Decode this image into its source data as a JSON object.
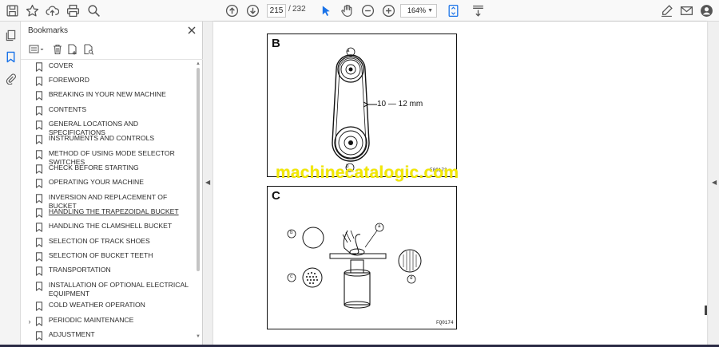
{
  "toolbar": {
    "page_current": "215",
    "page_separator": "/",
    "page_total": "232",
    "zoom": "164%"
  },
  "bookmarks": {
    "title": "Bookmarks",
    "items": [
      {
        "label": "COVER",
        "caret": ""
      },
      {
        "label": "FOREWORD",
        "caret": ""
      },
      {
        "label": "BREAKING IN YOUR NEW MACHINE",
        "caret": ""
      },
      {
        "label": "CONTENTS",
        "caret": ""
      },
      {
        "label": "GENERAL LOCATIONS AND SPECIFICATIONS",
        "caret": ""
      },
      {
        "label": "INSTRUMENTS AND CONTROLS",
        "caret": ""
      },
      {
        "label": "METHOD OF USING MODE SELECTOR SWITCHES",
        "caret": ""
      },
      {
        "label": "CHECK BEFORE STARTING",
        "caret": ""
      },
      {
        "label": "OPERATING YOUR MACHINE",
        "caret": ""
      },
      {
        "label": "INVERSION AND REPLACEMENT OF BUCKET",
        "caret": ""
      },
      {
        "label": "HANDLING THE TRAPEZOIDAL BUCKET",
        "caret": ""
      },
      {
        "label": "HANDLING THE CLAMSHELL BUCKET",
        "caret": ""
      },
      {
        "label": "SELECTION OF TRACK SHOES",
        "caret": ""
      },
      {
        "label": "SELECTION OF BUCKET TEETH",
        "caret": ""
      },
      {
        "label": "TRANSPORTATION",
        "caret": ""
      },
      {
        "label": "INSTALLATION OF OPTIONAL ELECTRICAL EQUIPMENT",
        "caret": ""
      },
      {
        "label": "COLD WEATHER OPERATION",
        "caret": ""
      },
      {
        "label": "PERIODIC MAINTENANCE",
        "caret": "›"
      },
      {
        "label": "ADJUSTMENT",
        "caret": ""
      }
    ]
  },
  "document": {
    "figure_b": {
      "letter": "B",
      "measurement": "10 — 12 mm",
      "callout_a": "a",
      "callout_b": "b",
      "code": "E00173"
    },
    "figure_c": {
      "letter": "C",
      "callout_a": "a",
      "callout_b": "b",
      "callout_c": "c",
      "callout_d": "d",
      "code": "FQ0174"
    },
    "watermark": "machinecatalogic.com"
  },
  "colors": {
    "accent": "#1a73e8",
    "watermark": "#f2e800"
  }
}
